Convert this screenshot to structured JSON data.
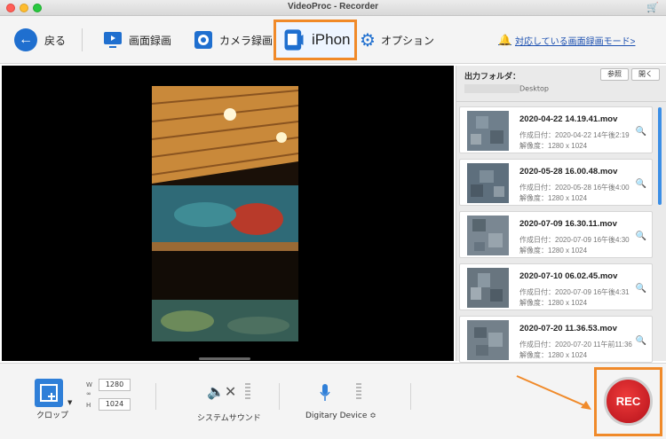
{
  "window": {
    "title": "VideoProc - Recorder"
  },
  "toolbar": {
    "back_label": "戻る",
    "screen_label": "画面録画",
    "camera_label": "カメラ録画",
    "iphone_label": "iPhon",
    "option_label": "オプション",
    "compatible_link": "対応している画面録画モード>"
  },
  "output": {
    "label": "出力フォルダ：",
    "browse_label": "参照",
    "open_label": "開く",
    "path_suffix": "Desktop"
  },
  "recordings": [
    {
      "name": "2020-04-22 14.19.41.mov",
      "created": "作成日付：2020-04-22 14午後2:19",
      "resolution": "解像度：1280 x 1024"
    },
    {
      "name": "2020-05-28 16.00.48.mov",
      "created": "作成日付：2020-05-28 16午後4:00",
      "resolution": "解像度：1280 x 1024"
    },
    {
      "name": "2020-07-09 16.30.11.mov",
      "created": "作成日付：2020-07-09 16午後4:30",
      "resolution": "解像度：1280 x 1024"
    },
    {
      "name": "2020-07-10 06.02.45.mov",
      "created": "作成日付：2020-07-09 16午後4:31",
      "resolution": "解像度：1280 x 1024"
    },
    {
      "name": "2020-07-20 11.36.53.mov",
      "created": "作成日付：2020-07-20 11午前11:36",
      "resolution": "解像度：1280 x 1024"
    }
  ],
  "crop": {
    "label": "クロップ",
    "w_label": "W",
    "h_label": "H",
    "width": "1280",
    "height": "1024"
  },
  "audio": {
    "system_label": "システムサウンド",
    "mic_label": "Digitary Device ≎"
  },
  "rec_label": "REC",
  "colors": {
    "accent": "#1f6fcf",
    "highlight": "#f08a2a",
    "rec": "#d01e26"
  }
}
